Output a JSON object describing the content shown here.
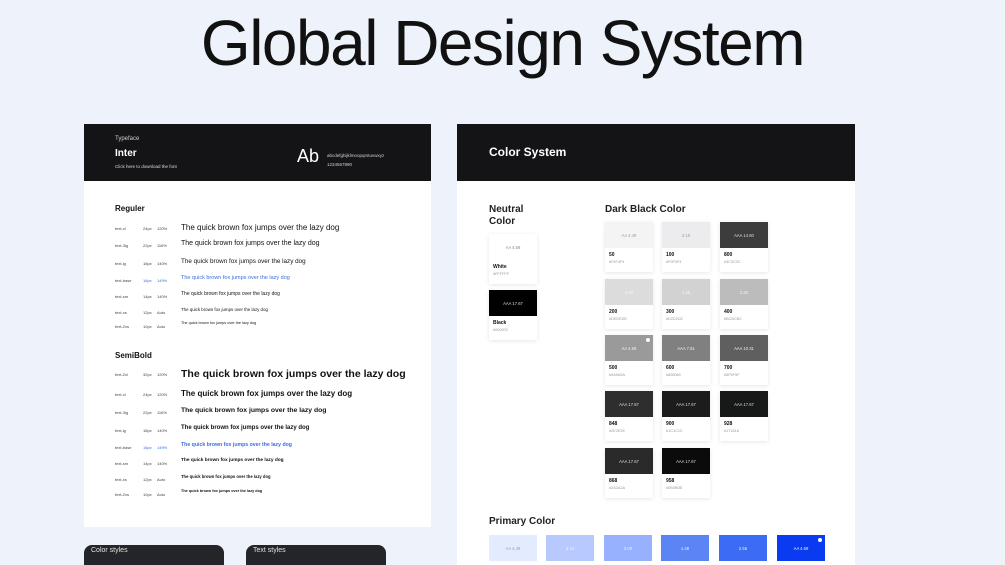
{
  "page": {
    "title": "Global Design System"
  },
  "typeface": {
    "label": "Typeface",
    "name": "Inter",
    "download_link": "Click here to download the font",
    "sample_glyph": "Ab",
    "lowercase": "abcdefghijklmnopqrstuvwxyz",
    "digits": "1234567890"
  },
  "regular": {
    "heading": "Reguler",
    "rows": [
      {
        "token": "text-xl",
        "size": "24px",
        "lh": "120%",
        "sample": "The quick brown fox jumps over the lazy dog"
      },
      {
        "token": "text-3lg",
        "size": "22px",
        "lh": "116%",
        "sample": "The quick brown fox jumps over the lazy dog"
      },
      {
        "token": "text-lg",
        "size": "18px",
        "lh": "140%",
        "sample": "The quick brown fox jumps over the lazy dog"
      },
      {
        "token": "text-base",
        "size": "16px",
        "lh": "149%",
        "sample": "The quick brown fox jumps over the lazy dog"
      },
      {
        "token": "text-sm",
        "size": "14px",
        "lh": "140%",
        "sample": "The quick brown fox jumps over the lazy dog"
      },
      {
        "token": "text-xs",
        "size": "12px",
        "lh": "Auto",
        "sample": "The quick brown fox jumps over the lazy dog"
      },
      {
        "token": "text-2xs",
        "size": "10px",
        "lh": "Auto",
        "sample": "The quick brown fox jumps over the lazy dog"
      }
    ]
  },
  "semibold": {
    "heading": "SemiBold",
    "rows": [
      {
        "token": "text-2xl",
        "size": "32px",
        "lh": "120%",
        "sample": "The quick brown fox jumps over the lazy dog"
      },
      {
        "token": "text-xl",
        "size": "24px",
        "lh": "120%",
        "sample": "The quick brown fox jumps over the lazy dog"
      },
      {
        "token": "text-3lg",
        "size": "22px",
        "lh": "116%",
        "sample": "The quick brown fox jumps over the lazy dog"
      },
      {
        "token": "text-lg",
        "size": "18px",
        "lh": "140%",
        "sample": "The quick brown fox jumps over the lazy dog"
      },
      {
        "token": "text-base",
        "size": "16px",
        "lh": "149%",
        "sample": "The quick brown fox jumps over the lazy dog"
      },
      {
        "token": "text-sm",
        "size": "14px",
        "lh": "140%",
        "sample": "The quick brown fox jumps over the lazy dog"
      },
      {
        "token": "text-xs",
        "size": "12px",
        "lh": "Auto",
        "sample": "The quick brown fox jumps over the lazy dog"
      },
      {
        "token": "text-2xs",
        "size": "10px",
        "lh": "Auto",
        "sample": "The quick brown fox jumps over the lazy dog"
      }
    ]
  },
  "bottom_cards": {
    "color_styles": "Color styles",
    "text_styles": "Text styles"
  },
  "color_system": {
    "title": "Color  System",
    "neutral": {
      "title_line1": "Neutral",
      "title_line2": "Color",
      "swatches": [
        {
          "name": "White",
          "hex": "#FFFFFF",
          "contrast": "AA 4.59",
          "color": "#ffffff",
          "text_color": "#888888"
        },
        {
          "name": "Black",
          "hex": "#000000",
          "contrast": "AAA 17.67",
          "color": "#000000",
          "text_color": "#dddddd"
        }
      ]
    },
    "dark": {
      "title": "Dark Black Color",
      "swatches": [
        {
          "name": "50",
          "hex": "#F4F4F4",
          "contrast": "AA 4.49",
          "color": "#f4f4f4",
          "text_color": "#9a9a9a"
        },
        {
          "name": "100",
          "hex": "#F0F0F4",
          "contrast": "4.15",
          "color": "#ececee",
          "text_color": "#9a9a9a"
        },
        {
          "name": "800",
          "hex": "#3C3C3C",
          "contrast": "AAA 14.60",
          "color": "#3c3c3c",
          "text_color": "#dddddd"
        },
        {
          "name": "200",
          "hex": "#DEDEDE",
          "contrast": "3.60",
          "color": "#dcdcdc",
          "text_color": "#f5f5f5"
        },
        {
          "name": "300",
          "hex": "#D2D2D2",
          "contrast": "1.45",
          "color": "#d2d2d2",
          "text_color": "#f5f5f5"
        },
        {
          "name": "400",
          "hex": "#BCBCBC",
          "contrast": "2.32",
          "color": "#bcbcbc",
          "text_color": "#f5f5f5"
        },
        {
          "name": "500",
          "hex": "#9A9A9A",
          "contrast": "AA 4.69",
          "color": "#9a9a9a",
          "text_color": "#f0f0f0",
          "marked": true
        },
        {
          "name": "600",
          "hex": "#808080",
          "contrast": "AAA 7.51",
          "color": "#808080",
          "text_color": "#f0f0f0"
        },
        {
          "name": "700",
          "hex": "#5F5F5F",
          "contrast": "AAA 10.31",
          "color": "#5f5f5f",
          "text_color": "#f0f0f0"
        },
        {
          "name": "848",
          "hex": "#2E2E2E",
          "contrast": "AAA 17.67",
          "color": "#2e2e2e",
          "text_color": "#dddddd"
        },
        {
          "name": "900",
          "hex": "#1C1C1C",
          "contrast": "AAA 17.67",
          "color": "#1c1c1c",
          "text_color": "#dddddd"
        },
        {
          "name": "928",
          "hex": "#171818",
          "contrast": "AAA 17.67",
          "color": "#171818",
          "text_color": "#dddddd"
        },
        {
          "name": "868",
          "hex": "#2A2A2A",
          "contrast": "AAA 17.67",
          "color": "#2a2a2a",
          "text_color": "#dddddd"
        },
        {
          "name": "958",
          "hex": "#0B0B0B",
          "contrast": "AAA 17.67",
          "color": "#0b0b0b",
          "text_color": "#dddddd"
        }
      ]
    },
    "primary": {
      "title": "Primary Color",
      "chips": [
        {
          "contrast": "AA 4.49",
          "color": "#e3ebff",
          "text_color": "#8aa0d6"
        },
        {
          "contrast": "4.15",
          "color": "#b7c9ff",
          "text_color": "#eef2ff"
        },
        {
          "contrast": "3.00",
          "color": "#97b1ff",
          "text_color": "#eef2ff"
        },
        {
          "contrast": "1.48",
          "color": "#5b84f5",
          "text_color": "#eef2ff"
        },
        {
          "contrast": "2.55",
          "color": "#3c6cf4",
          "text_color": "#eef2ff"
        },
        {
          "contrast": "AA 4.69",
          "color": "#0b3bf0",
          "text_color": "#eef2ff",
          "marked": true
        }
      ]
    }
  }
}
